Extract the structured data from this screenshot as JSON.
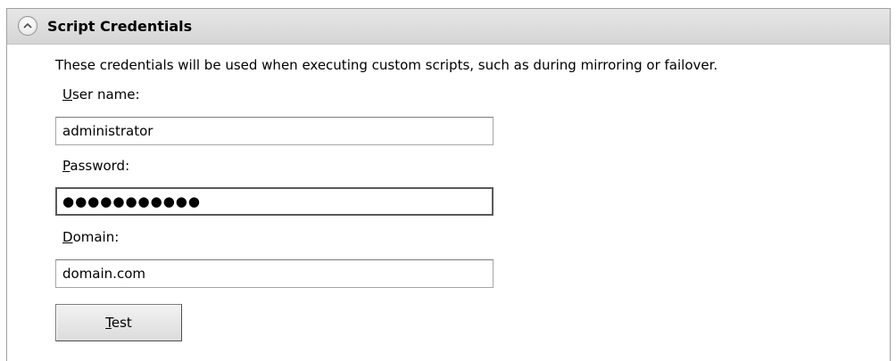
{
  "section": {
    "title": "Script Credentials",
    "description": "These credentials will be used when executing custom scripts, such as during mirroring or failover."
  },
  "fields": {
    "username": {
      "label_mnemonic": "U",
      "label_rest": "ser name:",
      "value": "administrator"
    },
    "password": {
      "label_mnemonic": "P",
      "label_rest": "assword:",
      "masked_value": "●●●●●●●●●●●"
    },
    "domain": {
      "label_mnemonic": "D",
      "label_rest": "omain:",
      "value": "domain.com"
    }
  },
  "buttons": {
    "test_mnemonic": "T",
    "test_rest": "est"
  },
  "icons": {
    "collapse": "chevron-up-icon"
  }
}
